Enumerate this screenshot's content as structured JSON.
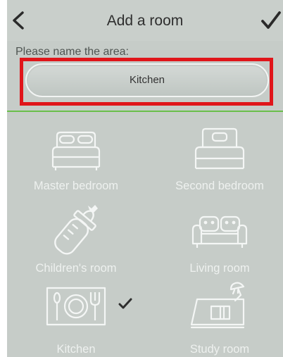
{
  "header": {
    "title": "Add a room",
    "back_icon": "chevron-left-icon",
    "confirm_icon": "checkmark-icon"
  },
  "form": {
    "prompt": "Please name the area:",
    "name_value": "Kitchen"
  },
  "rooms": [
    {
      "label": "Master bedroom",
      "icon": "double-bed-icon",
      "selected": false
    },
    {
      "label": "Second bedroom",
      "icon": "single-bed-icon",
      "selected": false
    },
    {
      "label": "Children's room",
      "icon": "baby-bottle-icon",
      "selected": false
    },
    {
      "label": "Living room",
      "icon": "sofa-icon",
      "selected": false
    },
    {
      "label": "Kitchen",
      "icon": "plate-cutlery-icon",
      "selected": true
    },
    {
      "label": "Study room",
      "icon": "desk-lamp-icon",
      "selected": false
    }
  ],
  "colors": {
    "accent_divider": "#6bbf4b",
    "highlight_border": "#e0151a",
    "screen_background": "#c6ccc8"
  }
}
